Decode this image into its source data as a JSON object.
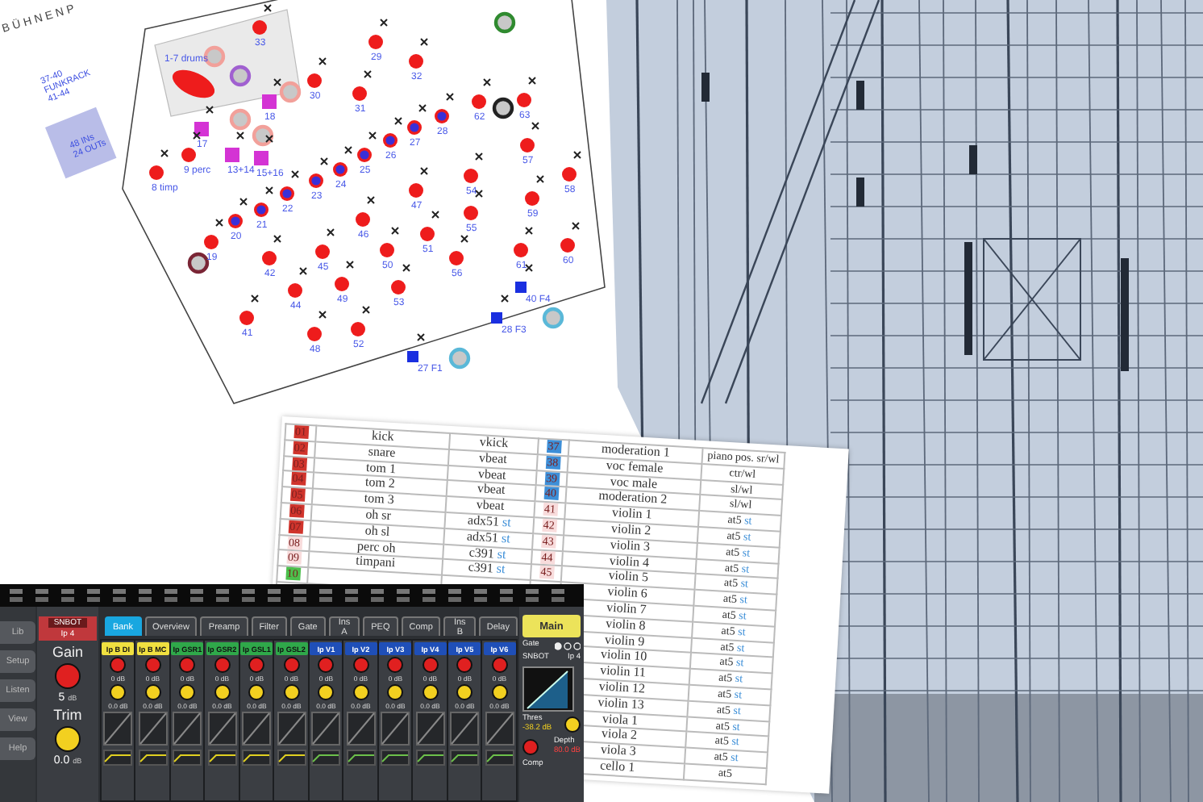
{
  "stage_plot": {
    "title": "BÜHNENP",
    "rack_labels": [
      [
        "37-40",
        "FUNKRACK",
        "41-44"
      ],
      [
        "48 INs",
        "24 OUTs"
      ]
    ],
    "markers": [
      {
        "label": "33",
        "kind": "dot"
      },
      {
        "label": "29",
        "kind": "dot"
      },
      {
        "label": "32",
        "kind": "dot"
      },
      {
        "label": "1-7 drums",
        "kind": "drums"
      },
      {
        "label": "18",
        "kind": "square"
      },
      {
        "label": "30",
        "kind": "dot"
      },
      {
        "label": "31",
        "kind": "dot"
      },
      {
        "label": "62",
        "kind": "dot"
      },
      {
        "label": "63",
        "kind": "dot"
      },
      {
        "label": "17",
        "kind": "square"
      },
      {
        "label": "26",
        "kind": "dot_inner"
      },
      {
        "label": "27",
        "kind": "dot_inner"
      },
      {
        "label": "28",
        "kind": "dot_inner"
      },
      {
        "label": "57",
        "kind": "dot"
      },
      {
        "label": "8 timp",
        "kind": "dot"
      },
      {
        "label": "9 perc",
        "kind": "dot"
      },
      {
        "label": "13+14",
        "kind": "square"
      },
      {
        "label": "15+16",
        "kind": "square"
      },
      {
        "label": "23",
        "kind": "dot_inner"
      },
      {
        "label": "24",
        "kind": "dot_inner"
      },
      {
        "label": "25",
        "kind": "dot_inner"
      },
      {
        "label": "54",
        "kind": "dot"
      },
      {
        "label": "58",
        "kind": "dot"
      },
      {
        "label": "20",
        "kind": "dot_inner"
      },
      {
        "label": "21",
        "kind": "dot_inner"
      },
      {
        "label": "22",
        "kind": "dot_inner"
      },
      {
        "label": "46",
        "kind": "dot"
      },
      {
        "label": "47",
        "kind": "dot"
      },
      {
        "label": "55",
        "kind": "dot"
      },
      {
        "label": "59",
        "kind": "dot"
      },
      {
        "label": "19",
        "kind": "dot"
      },
      {
        "label": "42",
        "kind": "dot"
      },
      {
        "label": "45",
        "kind": "dot"
      },
      {
        "label": "50",
        "kind": "dot"
      },
      {
        "label": "51",
        "kind": "dot"
      },
      {
        "label": "56",
        "kind": "dot"
      },
      {
        "label": "61",
        "kind": "dot"
      },
      {
        "label": "60",
        "kind": "dot"
      },
      {
        "label": "44",
        "kind": "dot"
      },
      {
        "label": "49",
        "kind": "dot"
      },
      {
        "label": "53",
        "kind": "dot"
      },
      {
        "label": "40 F4",
        "kind": "input"
      },
      {
        "label": "41",
        "kind": "dot"
      },
      {
        "label": "48",
        "kind": "dot"
      },
      {
        "label": "52",
        "kind": "dot"
      },
      {
        "label": "28 F3",
        "kind": "input"
      },
      {
        "label": "27 F1",
        "kind": "input"
      }
    ],
    "speakers": [
      {
        "color": "#f2a09a"
      },
      {
        "color": "#a060d0"
      },
      {
        "color": "#f2a09a"
      },
      {
        "color": "#f2a09a"
      },
      {
        "color": "#f2a09a"
      },
      {
        "color": "#2f8a2f"
      },
      {
        "color": "#222222"
      },
      {
        "color": "#7a2535"
      },
      {
        "color": "#5ab8d8"
      },
      {
        "color": "#5ab8d8"
      }
    ]
  },
  "patch_sheet": {
    "rows": [
      {
        "left": {
          "number": "01",
          "name": "kick",
          "mic": "vkick",
          "color": "#d0342c"
        },
        "right": {
          "number": "37",
          "name": "moderation 1",
          "mic": "piano pos. sr/wl",
          "color": "#3d8fd8"
        }
      },
      {
        "left": {
          "number": "02",
          "name": "snare",
          "mic": "vbeat",
          "color": "#d0342c"
        },
        "right": {
          "number": "38",
          "name": "voc female",
          "mic": "ctr/wl",
          "color": "#3d8fd8"
        }
      },
      {
        "left": {
          "number": "03",
          "name": "tom 1",
          "mic": "vbeat",
          "color": "#d0342c"
        },
        "right": {
          "number": "39",
          "name": "voc male",
          "mic": "sl/wl",
          "color": "#3d8fd8"
        }
      },
      {
        "left": {
          "number": "04",
          "name": "tom 2",
          "mic": "vbeat",
          "color": "#d0342c"
        },
        "right": {
          "number": "40",
          "name": "moderation 2",
          "mic": "sl/wl",
          "color": "#3d8fd8"
        }
      },
      {
        "left": {
          "number": "05",
          "name": "tom 3",
          "mic": "vbeat",
          "color": "#d0342c"
        },
        "right": {
          "number": "41",
          "name": "violin 1",
          "mic": "at5",
          "tag": "st",
          "color": "#f8dcdc"
        }
      },
      {
        "left": {
          "number": "06",
          "name": "oh sr",
          "mic": "adx51",
          "tag": "st",
          "color": "#d0342c"
        },
        "right": {
          "number": "42",
          "name": "violin 2",
          "mic": "at5",
          "tag": "st",
          "color": "#f8dcdc"
        }
      },
      {
        "left": {
          "number": "07",
          "name": "oh sl",
          "mic": "adx51",
          "tag": "st",
          "color": "#d0342c"
        },
        "right": {
          "number": "43",
          "name": "violin 3",
          "mic": "at5",
          "tag": "st",
          "color": "#f8dcdc"
        }
      },
      {
        "left": {
          "number": "08",
          "name": "perc oh",
          "mic": "c391",
          "tag": "st",
          "color": "#f8dcdc"
        },
        "right": {
          "number": "44",
          "name": "violin 4",
          "mic": "at5",
          "tag": "st",
          "color": "#f8dcdc"
        }
      },
      {
        "left": {
          "number": "09",
          "name": "timpani",
          "mic": "c391",
          "tag": "st",
          "color": "#f8dcdc"
        },
        "right": {
          "number": "45",
          "name": "violin 5",
          "mic": "at5",
          "tag": "st",
          "color": "#f8dcdc"
        }
      },
      {
        "left": {
          "number": "10",
          "color": "#4cc04c"
        },
        "right": {
          "name": "violin 6",
          "mic": "at5",
          "tag": "st"
        }
      },
      {
        "right": {
          "name": "violin 7",
          "mic": "at5",
          "tag": "st"
        }
      },
      {
        "right": {
          "name": "violin 8",
          "mic": "at5",
          "tag": "st"
        }
      },
      {
        "right": {
          "name": "violin 9",
          "mic": "at5",
          "tag": "st"
        }
      },
      {
        "right": {
          "name": "violin 10",
          "mic": "at5",
          "tag": "st"
        }
      },
      {
        "right": {
          "name": "violin 11",
          "mic": "at5",
          "tag": "st"
        }
      },
      {
        "right": {
          "name": "violin 12",
          "mic": "at5",
          "tag": "st"
        }
      },
      {
        "right": {
          "name": "violin 13",
          "mic": "at5",
          "tag": "st"
        }
      },
      {
        "right": {
          "name": "viola 1",
          "mic": "at5",
          "tag": "st"
        }
      },
      {
        "right": {
          "name": "viola 2",
          "mic": "at5",
          "tag": "st"
        }
      },
      {
        "right": {
          "name": "viola 3",
          "mic": "at5",
          "tag": "st"
        }
      },
      {
        "right": {
          "name": "cello 1",
          "mic": "at5"
        }
      }
    ]
  },
  "mixer": {
    "nav_buttons": [
      "Lib",
      "Setup",
      "Listen",
      "View",
      "Help"
    ],
    "channel": {
      "name": "SNBOT",
      "input": "Ip 4",
      "gain_label": "Gain",
      "gain_value": "5",
      "gain_unit": "dB",
      "trim_label": "Trim",
      "trim_value": "0.0",
      "trim_unit": "dB"
    },
    "tabs": [
      {
        "label": "Bank",
        "selected": true
      },
      {
        "label": "Overview",
        "selected": false
      },
      {
        "label": "Preamp",
        "selected": false
      },
      {
        "label": "Filter",
        "selected": false
      },
      {
        "label": "Gate",
        "selected": false
      },
      {
        "label": "Ins A",
        "selected": false
      },
      {
        "label": "PEQ",
        "selected": false
      },
      {
        "label": "Comp",
        "selected": false
      },
      {
        "label": "Ins B",
        "selected": false
      },
      {
        "label": "Delay",
        "selected": false
      }
    ],
    "strips": [
      {
        "name": "Ip B DI",
        "color": "#f0e040",
        "gain": "0 dB",
        "trim": "0.0 dB"
      },
      {
        "name": "Ip B MC",
        "color": "#f0e040",
        "gain": "0 dB",
        "trim": "0.0 dB"
      },
      {
        "name": "Ip GSR1",
        "color": "#2fa84a",
        "gain": "0 dB",
        "trim": "0.0 dB"
      },
      {
        "name": "Ip GSR2",
        "color": "#2fa84a",
        "gain": "0 dB",
        "trim": "0.0 dB"
      },
      {
        "name": "Ip GSL1",
        "color": "#2fa84a",
        "gain": "0 dB",
        "trim": "0.0 dB"
      },
      {
        "name": "Ip GSL2",
        "color": "#2fa84a",
        "gain": "0 dB",
        "trim": "0.0 dB"
      },
      {
        "name": "Ip V1",
        "color": "#1f4fb8",
        "gain": "0 dB",
        "trim": "0.0 dB"
      },
      {
        "name": "Ip V2",
        "color": "#1f4fb8",
        "gain": "0 dB",
        "trim": "0.0 dB"
      },
      {
        "name": "Ip V3",
        "color": "#1f4fb8",
        "gain": "0 dB",
        "trim": "0.0 dB"
      },
      {
        "name": "Ip V4",
        "color": "#1f4fb8",
        "gain": "0 dB",
        "trim": "0.0 dB"
      },
      {
        "name": "Ip V5",
        "color": "#1f4fb8",
        "gain": "0 dB",
        "trim": "0.0 dB"
      },
      {
        "name": "Ip V6",
        "color": "#1f4fb8",
        "gain": "0 dB",
        "trim": "0.0 dB"
      }
    ],
    "main_button": "Main",
    "gate": {
      "label": "Gate",
      "source": "SNBOT",
      "input": "Ip 4",
      "thres_label": "Thres",
      "thres_value": "-38.2 dB",
      "depth_label": "Depth",
      "depth_value": "80.0 dB"
    },
    "comp_label": "Comp"
  }
}
